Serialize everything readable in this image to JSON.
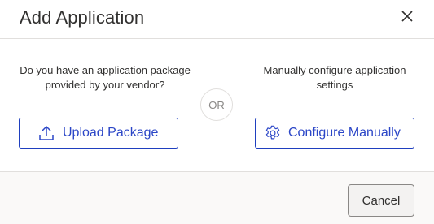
{
  "dialog": {
    "title": "Add Application",
    "close_icon": "close-icon"
  },
  "left": {
    "prompt": "Do you have an application package provided by your vendor?",
    "button_label": "Upload Package",
    "button_icon": "upload-icon"
  },
  "separator": {
    "label": "OR"
  },
  "right": {
    "prompt": "Manually configure application settings",
    "button_label": "Configure Manually",
    "button_icon": "gear-icon"
  },
  "footer": {
    "cancel_label": "Cancel"
  },
  "colors": {
    "accent": "#2b46c7",
    "border": "#e1dfdd",
    "footer_bg": "#faf9f8",
    "text": "#323130"
  }
}
